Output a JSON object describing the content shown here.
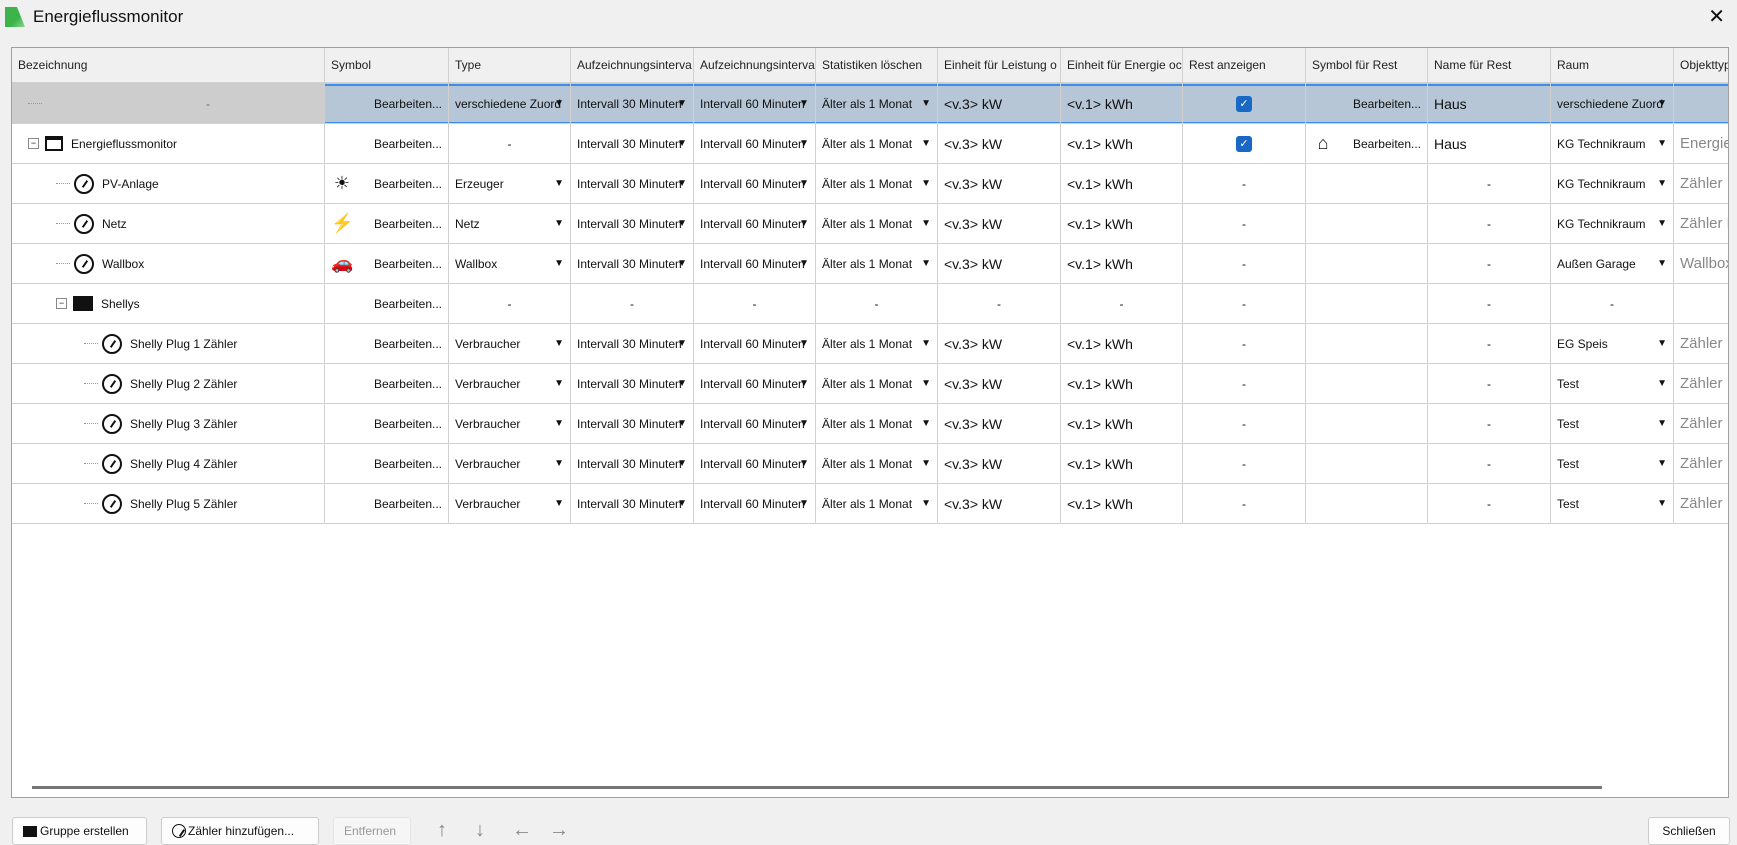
{
  "window": {
    "title": "Energieflussmonitor",
    "close": "✕"
  },
  "columns": [
    "Bezeichnung",
    "Symbol",
    "Type",
    "Aufzeichnungsinterva",
    "Aufzeichnungsinterva",
    "Statistiken löschen",
    "Einheit für Leistung o",
    "Einheit für Energie oc",
    "Rest anzeigen",
    "Symbol für Rest",
    "Name für Rest",
    "Raum",
    "Objekttyp"
  ],
  "rows": [
    {
      "name": "-",
      "level": 0,
      "icon": "none",
      "symbol": "Bearbeiten...",
      "type": "verschiedene Zuord",
      "int1": "Intervall 30 Minuten",
      "int2": "Intervall 60 Minuten",
      "stat": "Älter als 1 Monat",
      "power": "<v.3> kW",
      "energy": "<v.1> kWh",
      "rest": "checked",
      "restsym": "Bearbeiten...",
      "restname": "Haus",
      "raum": "verschiedene Zuord",
      "objtype": "",
      "selected": true
    },
    {
      "name": "Energieflussmonitor",
      "level": 0,
      "icon": "window",
      "symbol": "Bearbeiten...",
      "type": "-",
      "int1": "Intervall 30 Minuten",
      "int2": "Intervall 60 Minuten",
      "stat": "Älter als 1 Monat",
      "power": "<v.3> kW",
      "energy": "<v.1> kWh",
      "rest": "checked",
      "restsym": "Bearbeiten...",
      "restname": "Haus",
      "raum": "KG Technikraum",
      "objtype": "Energieflussmonitor"
    },
    {
      "name": "PV-Anlage",
      "level": 1,
      "icon": "gauge",
      "symicon": "☀",
      "symbol": "Bearbeiten...",
      "type": "Erzeuger",
      "int1": "Intervall 30 Minuten",
      "int2": "Intervall 60 Minuten",
      "stat": "Älter als 1 Monat",
      "power": "<v.3> kW",
      "energy": "<v.1> kWh",
      "rest": "-",
      "restsym": "",
      "restname": "-",
      "raum": "KG Technikraum",
      "objtype": "Zähler"
    },
    {
      "name": "Netz",
      "level": 1,
      "icon": "gauge",
      "symicon": "⚡",
      "symbol": "Bearbeiten...",
      "type": "Netz",
      "int1": "Intervall 30 Minuten",
      "int2": "Intervall 60 Minuten",
      "stat": "Älter als 1 Monat",
      "power": "<v.3> kW",
      "energy": "<v.1> kWh",
      "rest": "-",
      "restsym": "",
      "restname": "-",
      "raum": "KG Technikraum",
      "objtype": "Zähler Bezug"
    },
    {
      "name": "Wallbox",
      "level": 1,
      "icon": "gauge",
      "symicon": "🚗",
      "symbol": "Bearbeiten...",
      "type": "Wallbox",
      "int1": "Intervall 30 Minuten",
      "int2": "Intervall 60 Minuten",
      "stat": "Älter als 1 Monat",
      "power": "<v.3> kW",
      "energy": "<v.1> kWh",
      "rest": "-",
      "restsym": "",
      "restname": "-",
      "raum": "Außen Garage",
      "objtype": "Wallbox"
    },
    {
      "name": "Shellys",
      "level": 1,
      "icon": "folder",
      "symbol": "Bearbeiten...",
      "type": "-",
      "int1": "-",
      "int2": "-",
      "stat": "-",
      "power": "-",
      "energy": "-",
      "rest": "-",
      "restsym": "",
      "restname": "-",
      "raum": "-",
      "objtype": "",
      "group": true
    },
    {
      "name": "Shelly Plug 1 Zähler",
      "level": 2,
      "icon": "gauge",
      "symbol": "Bearbeiten...",
      "type": "Verbraucher",
      "int1": "Intervall 30 Minuten",
      "int2": "Intervall 60 Minuten",
      "stat": "Älter als 1 Monat",
      "power": "<v.3> kW",
      "energy": "<v.1> kWh",
      "rest": "-",
      "restsym": "",
      "restname": "-",
      "raum": "EG Speis",
      "objtype": "Zähler"
    },
    {
      "name": "Shelly Plug 2 Zähler",
      "level": 2,
      "icon": "gauge",
      "symbol": "Bearbeiten...",
      "type": "Verbraucher",
      "int1": "Intervall 30 Minuten",
      "int2": "Intervall 60 Minuten",
      "stat": "Älter als 1 Monat",
      "power": "<v.3> kW",
      "energy": "<v.1> kWh",
      "rest": "-",
      "restsym": "",
      "restname": "-",
      "raum": "Test",
      "objtype": "Zähler"
    },
    {
      "name": "Shelly Plug 3 Zähler",
      "level": 2,
      "icon": "gauge",
      "symbol": "Bearbeiten...",
      "type": "Verbraucher",
      "int1": "Intervall 30 Minuten",
      "int2": "Intervall 60 Minuten",
      "stat": "Älter als 1 Monat",
      "power": "<v.3> kW",
      "energy": "<v.1> kWh",
      "rest": "-",
      "restsym": "",
      "restname": "-",
      "raum": "Test",
      "objtype": "Zähler"
    },
    {
      "name": "Shelly Plug 4 Zähler",
      "level": 2,
      "icon": "gauge",
      "symbol": "Bearbeiten...",
      "type": "Verbraucher",
      "int1": "Intervall 30 Minuten",
      "int2": "Intervall 60 Minuten",
      "stat": "Älter als 1 Monat",
      "power": "<v.3> kW",
      "energy": "<v.1> kWh",
      "rest": "-",
      "restsym": "",
      "restname": "-",
      "raum": "Test",
      "objtype": "Zähler"
    },
    {
      "name": "Shelly Plug 5 Zähler",
      "level": 2,
      "icon": "gauge",
      "symbol": "Bearbeiten...",
      "type": "Verbraucher",
      "int1": "Intervall 30 Minuten",
      "int2": "Intervall 60 Minuten",
      "stat": "Älter als 1 Monat",
      "power": "<v.3> kW",
      "energy": "<v.1> kWh",
      "rest": "-",
      "restsym": "",
      "restname": "-",
      "raum": "Test",
      "objtype": "Zähler"
    }
  ],
  "buttons": {
    "group": "Gruppe erstellen",
    "add": "Zähler hinzufügen...",
    "remove": "Entfernen",
    "close": "Schließen"
  }
}
